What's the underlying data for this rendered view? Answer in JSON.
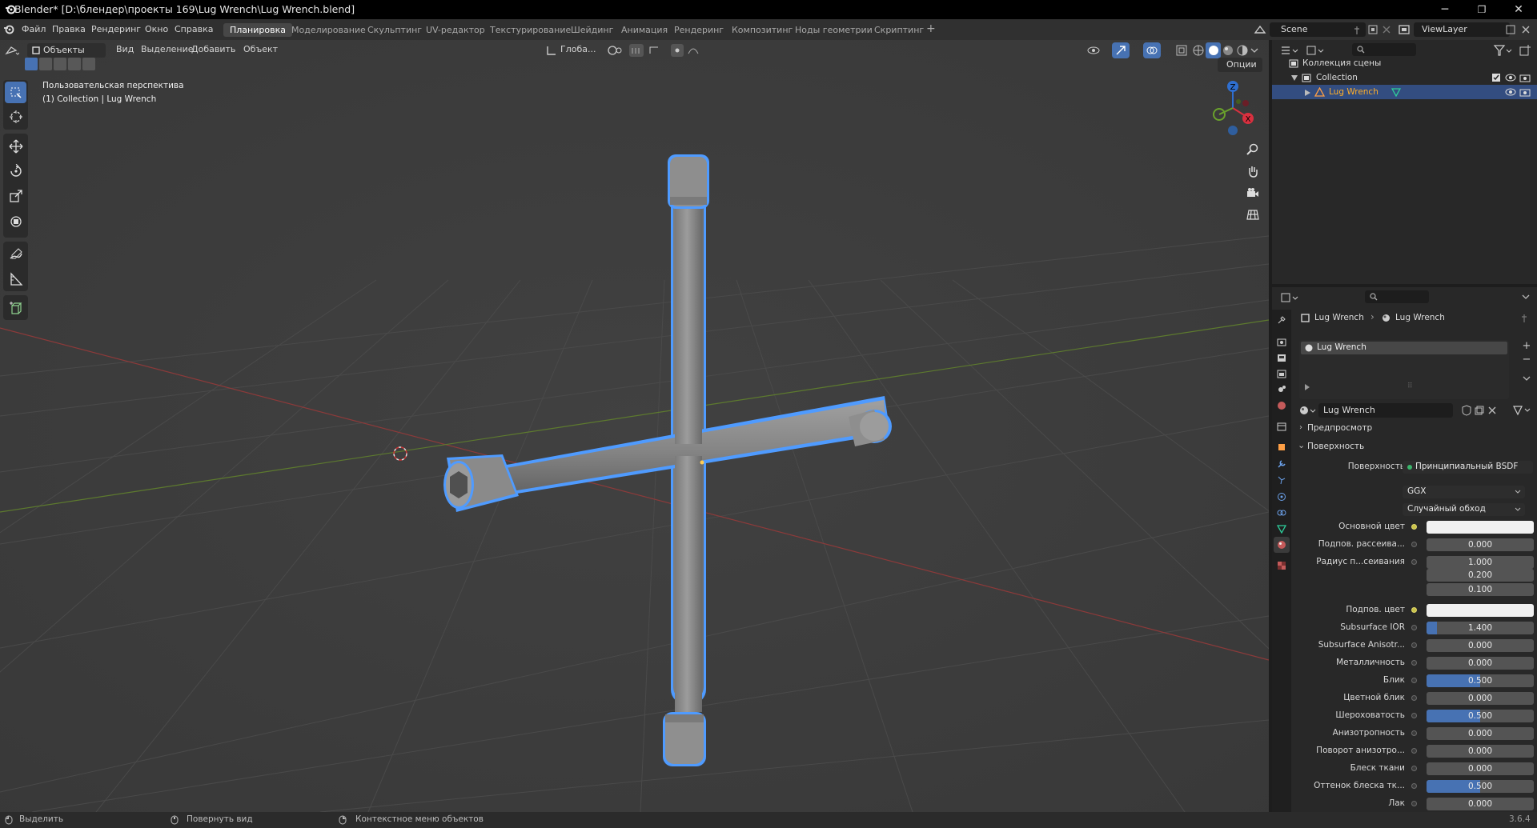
{
  "window": {
    "title": "Blender* [D:\\блендер\\проекты 169\\Lug Wrench\\Lug Wrench.blend]",
    "controls": {
      "minimize": "─",
      "maximize": "❐",
      "close": "✕"
    }
  },
  "menu": {
    "items": [
      "Файл",
      "Правка",
      "Рендеринг",
      "Окно",
      "Справка"
    ],
    "workspaces": [
      "Планировка",
      "Моделирование",
      "Скульптинг",
      "UV-редактор",
      "Текстурирование",
      "Шейдинг",
      "Анимация",
      "Рендеринг",
      "Композитинг",
      "Ноды геометрии",
      "Скриптинг"
    ],
    "active_workspace": "Планировка",
    "add_workspace": "+",
    "scene": "Scene",
    "view_layer": "ViewLayer"
  },
  "viewport": {
    "mode": "Объекты",
    "menus": [
      "Вид",
      "Выделение",
      "Добавить",
      "Объект"
    ],
    "transform_orientation": "Глоба...",
    "options_label": "Опции",
    "overlay_line1": "Пользовательская перспектива",
    "overlay_line2": "(1) Collection | Lug Wrench",
    "gizmo": {
      "x": "X",
      "y": "Y",
      "z": "Z"
    },
    "object_color": "#8f8f8f",
    "selection_color": "#4f9bff"
  },
  "outliner": {
    "root": "Коллекция сцены",
    "collection": "Collection",
    "object": "Lug Wrench"
  },
  "properties": {
    "breadcrumb": [
      "Lug Wrench",
      "Lug Wrench"
    ],
    "slot": "Lug Wrench",
    "material_name": "Lug Wrench",
    "sections": {
      "preview": "Предпросмотр",
      "surface": "Поверхность"
    },
    "surface_label": "Поверхность",
    "surface_shader": "Принципиальный BSDF",
    "distribution": "GGX",
    "subsurface_method": "Случайный обход",
    "rows": [
      {
        "label": "Основной цвет",
        "value": "",
        "kind": "color"
      },
      {
        "label": "Подпов. рассеива...",
        "value": "0.000",
        "fill": 0
      },
      {
        "label": "Радиус п...сеивания",
        "value": "1.000",
        "fill": 0
      },
      {
        "label": "",
        "value": "0.200",
        "fill": 0
      },
      {
        "label": "",
        "value": "0.100",
        "fill": 0
      },
      {
        "label": "Подпов. цвет",
        "value": "",
        "kind": "color"
      },
      {
        "label": "Subsurface IOR",
        "value": "1.400",
        "fill": 0.1
      },
      {
        "label": "Subsurface Anisotr...",
        "value": "0.000",
        "fill": 0
      },
      {
        "label": "Металличность",
        "value": "0.000",
        "fill": 0
      },
      {
        "label": "Блик",
        "value": "0.500",
        "fill": 0.5
      },
      {
        "label": "Цветной блик",
        "value": "0.000",
        "fill": 0
      },
      {
        "label": "Шероховатость",
        "value": "0.500",
        "fill": 0.5
      },
      {
        "label": "Анизотропность",
        "value": "0.000",
        "fill": 0
      },
      {
        "label": "Поворот анизотро...",
        "value": "0.000",
        "fill": 0
      },
      {
        "label": "Блеск ткани",
        "value": "0.000",
        "fill": 0
      },
      {
        "label": "Оттенок блеска тк...",
        "value": "0.500",
        "fill": 0.5
      },
      {
        "label": "Лак",
        "value": "0.000",
        "fill": 0
      }
    ]
  },
  "status": {
    "select": "Выделить",
    "rotate": "Повернуть вид",
    "context": "Контекстное меню объектов",
    "version": "3.6.4"
  }
}
